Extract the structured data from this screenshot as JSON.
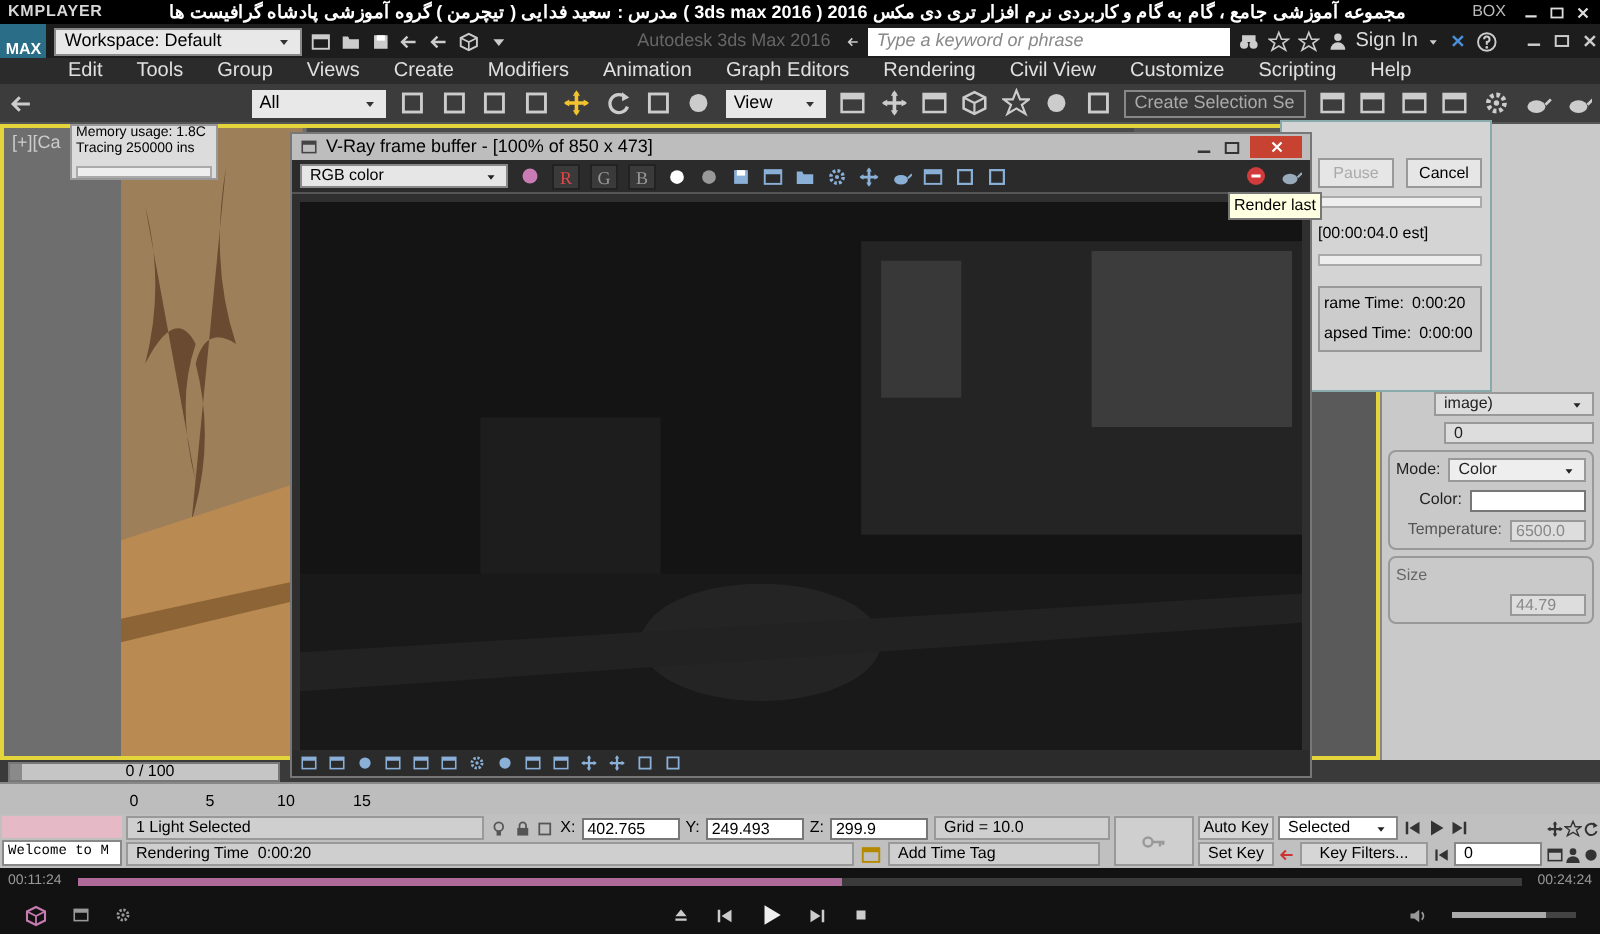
{
  "player": {
    "app_name": "KMPLAYER",
    "title": "مجموعه آموزشی جامع ، گام به گام و کاربردی نرم افزار تری دی مکس 2016 ( 3ds max 2016 )  مدرس : سعید فدایی ( تیچرمن ) گروه آموزشی پادشاه گرافیست ها",
    "box_label": "BOX",
    "elapsed": "00:11:24",
    "duration": "00:24:24",
    "progress": {
      "level": 0.53
    },
    "volume": {
      "level": 0.75
    }
  },
  "max": {
    "logo": "MAX",
    "workspace": "Workspace: Default",
    "app_title": "Autodesk 3ds Max 2016",
    "search_placeholder": "Type a keyword or phrase",
    "sign_in": "Sign In",
    "menu": [
      "Edit",
      "Tools",
      "Group",
      "Views",
      "Create",
      "Modifiers",
      "Animation",
      "Graph Editors",
      "Rendering",
      "Civil View",
      "Customize",
      "Scripting",
      "Help"
    ],
    "selection_filter": "All",
    "reference_coord": "View",
    "named_selection_placeholder": "Create Selection Se"
  },
  "viewport": {
    "label": "[+][Ca",
    "log_lines": [
      "Memory usage: 1.8C",
      "Tracing 250000 ins"
    ]
  },
  "vfb": {
    "title": "V-Ray frame buffer - [100% of 850 x 473]",
    "channel": "RGB color",
    "channel_buttons": [
      {
        "label": "R",
        "on": true
      },
      {
        "label": "G",
        "on": false
      },
      {
        "label": "B",
        "on": false
      }
    ],
    "tooltip": "Render last"
  },
  "render_dialog": {
    "pause": {
      "label": "Pause",
      "disabled": true
    },
    "cancel": {
      "label": "Cancel",
      "disabled": false
    },
    "estimate": "[00:00:04.0 est]",
    "rows": [
      {
        "label": "rame Time:",
        "value": "0:00:20"
      },
      {
        "label": "apsed Time:",
        "value": "0:00:00"
      }
    ]
  },
  "command_panel": {
    "dropdown": "image)",
    "spinner": "0",
    "mode_label": "Mode:",
    "mode": "Color",
    "color_label": "Color:",
    "temperature_label": "Temperature:",
    "temperature": "6500.0",
    "size_label": "Size",
    "size_value": "44.79"
  },
  "timeline": {
    "frame": "0 / 100",
    "level": 0,
    "ticks": [
      "0",
      "5",
      "10",
      "15"
    ]
  },
  "status": {
    "listener": "Welcome to M",
    "selection": "1 Light Selected",
    "prompt": "Rendering Time  0:00:20",
    "coords": [
      {
        "label": "X:",
        "value": "402.765"
      },
      {
        "label": "Y:",
        "value": "249.493"
      },
      {
        "label": "Z:",
        "value": "299.9"
      }
    ],
    "grid": "Grid = 10.0",
    "add_time_tag": "Add Time Tag",
    "auto_key": "Auto Key",
    "set_key": "Set Key",
    "key_mode": "Selected",
    "key_filters": "Key Filters...",
    "frame": "0"
  }
}
